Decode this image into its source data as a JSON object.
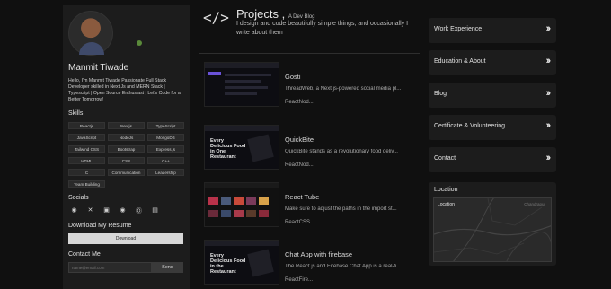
{
  "profile": {
    "name": "Manmit Tiwade",
    "bio": "Hello, I'm Manmit Tiwade Passionate Full Stack Developer skilled in Next Js and MERN Stack | Typescript | Open Source Enthusiast | Let's Code for a Better Tomorrow!",
    "status_color": "#5a8a3a"
  },
  "skills": {
    "heading": "Skills",
    "items": [
      "Reactjs",
      "Nextjs",
      "TypeScript",
      "JavaScript",
      "NodeJs",
      "MongoDB",
      "Tailwind CSS",
      "Bootstrap",
      "Express.js",
      "HTML",
      "CSS",
      "C++",
      "C",
      "Communication",
      "Leadership",
      "Team Building"
    ]
  },
  "socials": {
    "heading": "Socials",
    "icons": [
      "github-icon",
      "x-icon",
      "linkedin-icon",
      "instagram-icon",
      "facebook-icon",
      "stats-icon"
    ]
  },
  "resume": {
    "heading": "Download My Resume",
    "button": "Download"
  },
  "contact": {
    "heading": "Contact Me",
    "placeholder": "name@email.com",
    "button": "Send"
  },
  "projects": {
    "title": "Projects ,",
    "subtitle": "A Dev Blog",
    "description": "I design and code beautifully simple things, and occasionally I write about them",
    "items": [
      {
        "title": "Gosti",
        "desc": "ThreadWeb, a Next.js-powered social media pl...",
        "tags": "ReactNod..."
      },
      {
        "title": "QuickBite",
        "desc": "QuickBite stands as a revolutionary food deliv...",
        "tags": "ReactNod..."
      },
      {
        "title": "React Tube",
        "desc": "Make sure to adjust the paths in the import st...",
        "tags": "ReactCSS..."
      },
      {
        "title": "Chat App with firebase",
        "desc": "The React.js and Firebase Chat App is a real-ti...",
        "tags": "ReactFire..."
      }
    ]
  },
  "thumbs": {
    "quickbite_text": "Every Delicious Food in One Restaurant",
    "chat_text": "Every Delicious Food in the Restaurant"
  },
  "nav": {
    "items": [
      "Work Experience",
      "Education & About",
      "Blog",
      "Certificate & Volunteering",
      "Contact"
    ]
  },
  "location": {
    "heading": "Location",
    "map_label": "Location",
    "map_city": "Chandrapur"
  },
  "colors": {
    "background": "#101010",
    "panel": "#1c1c1c",
    "accent": "#6a52d8"
  }
}
